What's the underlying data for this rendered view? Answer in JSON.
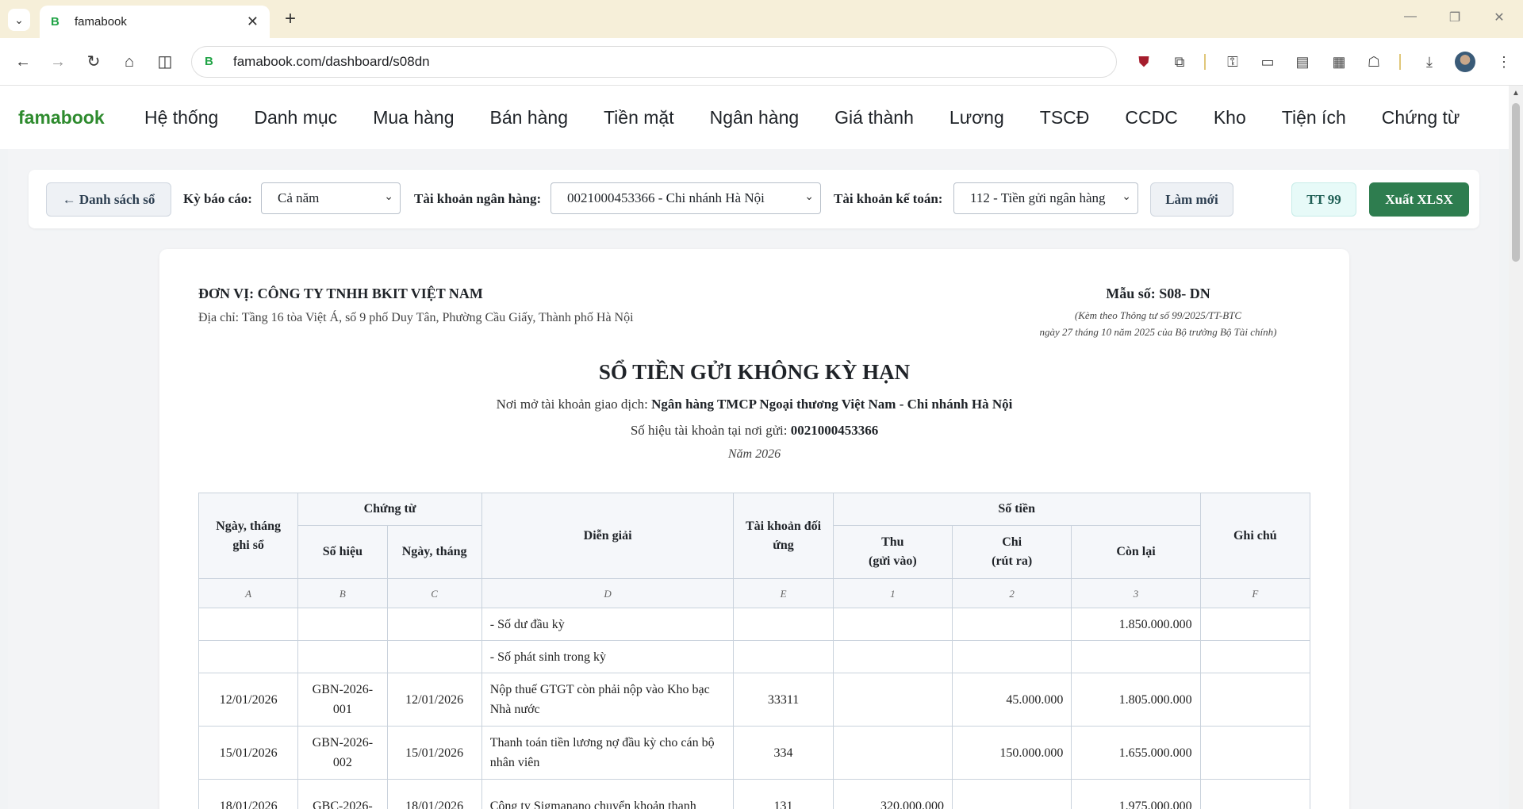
{
  "browser": {
    "tab_title": "famabook",
    "favicon_letter": "B",
    "url": "famabook.com/dashboard/s08dn",
    "extension_badge": "1"
  },
  "app": {
    "brand": "famabook",
    "menu": [
      "Hệ thống",
      "Danh mục",
      "Mua hàng",
      "Bán hàng",
      "Tiền mặt",
      "Ngân hàng",
      "Giá thành",
      "Lương",
      "TSCĐ",
      "CCDC",
      "Kho",
      "Tiện ích",
      "Chứng từ"
    ]
  },
  "filters": {
    "back_label": "← Danh sách sổ",
    "period_label": "Kỳ báo cáo:",
    "period_value": "Cả năm",
    "bank_account_label": "Tài khoản ngân hàng:",
    "bank_account_value": "0021000453366 - Chi nhánh Hà Nội",
    "gl_account_label": "Tài khoản kế toán:",
    "gl_account_value": "112 - Tiền gửi ngân hàng",
    "refresh_label": "Làm mới",
    "circular_label": "TT 99",
    "export_label": "Xuất XLSX"
  },
  "report": {
    "unit_name": "ĐƠN VỊ: CÔNG TY TNHH BKIT VIỆT NAM",
    "address": "Địa chỉ: Tầng 16 tòa Việt Á, số 9 phố Duy Tân, Phường Cầu Giấy, Thành phố Hà Nội",
    "form_no": "Mẫu số: S08- DN",
    "form_note_1": "(Kèm theo Thông tư số 99/2025/TT-BTC",
    "form_note_2": "ngày 27 tháng 10 năm 2025 của Bộ trưởng Bộ Tài chính)",
    "title": "SỔ TIỀN GỬI KHÔNG KỲ HẠN",
    "bank_prefix": "Nơi mở tài khoản giao dịch: ",
    "bank_name": "Ngân hàng TMCP Ngoại thương Việt Nam - Chi nhánh Hà Nội",
    "account_prefix": "Số hiệu tài khoản tại nơi gửi: ",
    "account_no": "0021000453366",
    "year": "Năm 2026"
  },
  "table": {
    "headers": {
      "date": "Ngày, tháng ghi sổ",
      "voucher": "Chứng từ",
      "voucher_no": "Số hiệu",
      "voucher_date": "Ngày, tháng",
      "description": "Diễn giải",
      "counter_account": "Tài khoản đối ứng",
      "amount": "Số tiền",
      "in_1": "Thu",
      "in_2": "(gửi vào)",
      "out_1": "Chi",
      "out_2": "(rút ra)",
      "balance": "Còn lại",
      "note": "Ghi chú"
    },
    "letters": [
      "A",
      "B",
      "C",
      "D",
      "E",
      "1",
      "2",
      "3",
      "F"
    ],
    "rows": [
      {
        "date": "",
        "voucher_no": "",
        "voucher_date": "",
        "description": "- Số dư đầu kỳ",
        "account": "",
        "in": "",
        "out": "",
        "balance": "1.850.000.000",
        "note": ""
      },
      {
        "date": "",
        "voucher_no": "",
        "voucher_date": "",
        "description": "- Số phát sinh trong kỳ",
        "account": "",
        "in": "",
        "out": "",
        "balance": "",
        "note": ""
      },
      {
        "date": "12/01/2026",
        "voucher_no": "GBN-2026-001",
        "voucher_date": "12/01/2026",
        "description": "Nộp thuế GTGT còn phải nộp vào Kho bạc Nhà nước",
        "account": "33311",
        "in": "",
        "out": "45.000.000",
        "balance": "1.805.000.000",
        "note": ""
      },
      {
        "date": "15/01/2026",
        "voucher_no": "GBN-2026-002",
        "voucher_date": "15/01/2026",
        "description": "Thanh toán tiền lương nợ đầu kỳ cho cán bộ nhân viên",
        "account": "334",
        "in": "",
        "out": "150.000.000",
        "balance": "1.655.000.000",
        "note": ""
      },
      {
        "date": "18/01/2026",
        "voucher_no": "GBC-2026-",
        "voucher_date": "18/01/2026",
        "description": "Công ty Sigmanano chuyển khoản thanh",
        "account": "131",
        "in": "320.000.000",
        "out": "",
        "balance": "1.975.000.000",
        "note": ""
      }
    ]
  }
}
